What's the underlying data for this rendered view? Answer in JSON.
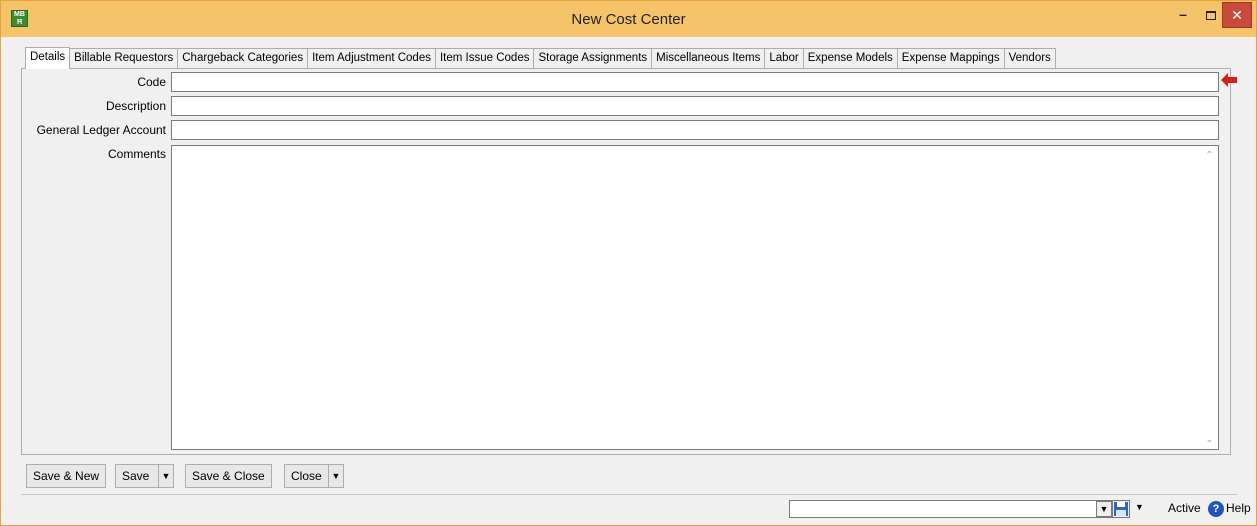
{
  "window": {
    "title": "New Cost Center",
    "app_icon_text": "MB\nfl",
    "colors": {
      "titlebar": "#f5c36a",
      "close": "#c74a3b",
      "required_arrow": "#d0231b"
    }
  },
  "tabs": [
    {
      "label": "Details",
      "active": true
    },
    {
      "label": "Billable Requestors"
    },
    {
      "label": "Chargeback Categories"
    },
    {
      "label": "Item Adjustment Codes"
    },
    {
      "label": "Item Issue Codes"
    },
    {
      "label": "Storage Assignments"
    },
    {
      "label": "Miscellaneous Items"
    },
    {
      "label": "Labor"
    },
    {
      "label": "Expense Models"
    },
    {
      "label": "Expense Mappings"
    },
    {
      "label": "Vendors"
    }
  ],
  "form": {
    "code": {
      "label": "Code",
      "value": ""
    },
    "description": {
      "label": "Description",
      "value": ""
    },
    "gl_account": {
      "label": "General Ledger Account",
      "value": ""
    },
    "comments": {
      "label": "Comments",
      "value": ""
    }
  },
  "buttons": {
    "save_new": "Save & New",
    "save": "Save",
    "save_close": "Save & Close",
    "close": "Close"
  },
  "status": {
    "combo_value": "",
    "active_label": "Active",
    "help_label": "Help"
  }
}
